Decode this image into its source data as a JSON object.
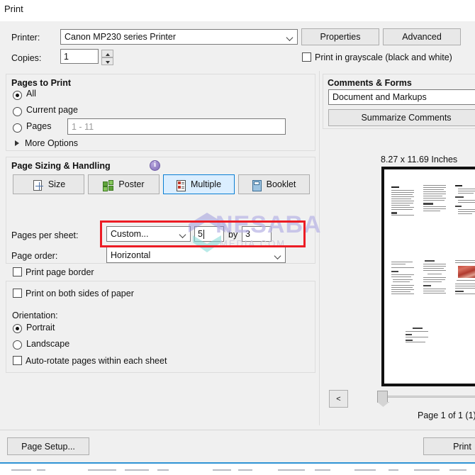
{
  "window": {
    "title": "Print"
  },
  "printer": {
    "label": "Printer:",
    "value": "Canon MP230 series Printer",
    "properties_label": "Properties",
    "advanced_label": "Advanced"
  },
  "copies": {
    "label": "Copies:",
    "value": "1"
  },
  "grayscale": {
    "label": "Print in grayscale (black and white)",
    "checked": false
  },
  "pages_to_print": {
    "title": "Pages to Print",
    "options": [
      {
        "label": "All",
        "selected": true
      },
      {
        "label": "Current page",
        "selected": false
      },
      {
        "label": "Pages",
        "selected": false
      }
    ],
    "pages_placeholder": "1 - 11",
    "more_options_label": "More Options"
  },
  "page_sizing": {
    "title": "Page Sizing & Handling",
    "info_icon": "info-icon",
    "modes": [
      {
        "label": "Size",
        "icon": "size-icon",
        "selected": false
      },
      {
        "label": "Poster",
        "icon": "poster-icon",
        "selected": false
      },
      {
        "label": "Multiple",
        "icon": "multiple-icon",
        "selected": true
      },
      {
        "label": "Booklet",
        "icon": "booklet-icon",
        "selected": false
      }
    ],
    "pages_per_sheet": {
      "label": "Pages per sheet:",
      "value": "Custom...",
      "columns": "5",
      "by_label": "by",
      "rows": "3",
      "highlight_color": "#ec1c24"
    },
    "page_order": {
      "label": "Page order:",
      "value": "Horizontal"
    },
    "print_page_border": {
      "label": "Print page border",
      "checked": false
    }
  },
  "duplex": {
    "label": "Print on both sides of paper",
    "checked": false
  },
  "orientation": {
    "title": "Orientation:",
    "options": [
      {
        "label": "Portrait",
        "selected": true
      },
      {
        "label": "Landscape",
        "selected": false
      }
    ],
    "auto_rotate": {
      "label": "Auto-rotate pages within each sheet",
      "checked": false
    }
  },
  "comments_forms": {
    "title": "Comments & Forms",
    "value": "Document and Markups",
    "summarize_label": "Summarize Comments"
  },
  "preview": {
    "dimensions": "8.27 x 11.69 Inches",
    "prev_button_label": "<",
    "page_indicator": "Page 1 of 1 (1)"
  },
  "footer": {
    "page_setup_label": "Page Setup...",
    "print_label": "Print"
  },
  "watermark": {
    "brand": "NESABA",
    "sub": "MEDIA.COM",
    "color": "#b9b5e6"
  },
  "theme": {
    "accent": "#0a7fd4",
    "dialog_bg": "#f0f0f0",
    "bottom_rule": "#2f93d4"
  }
}
